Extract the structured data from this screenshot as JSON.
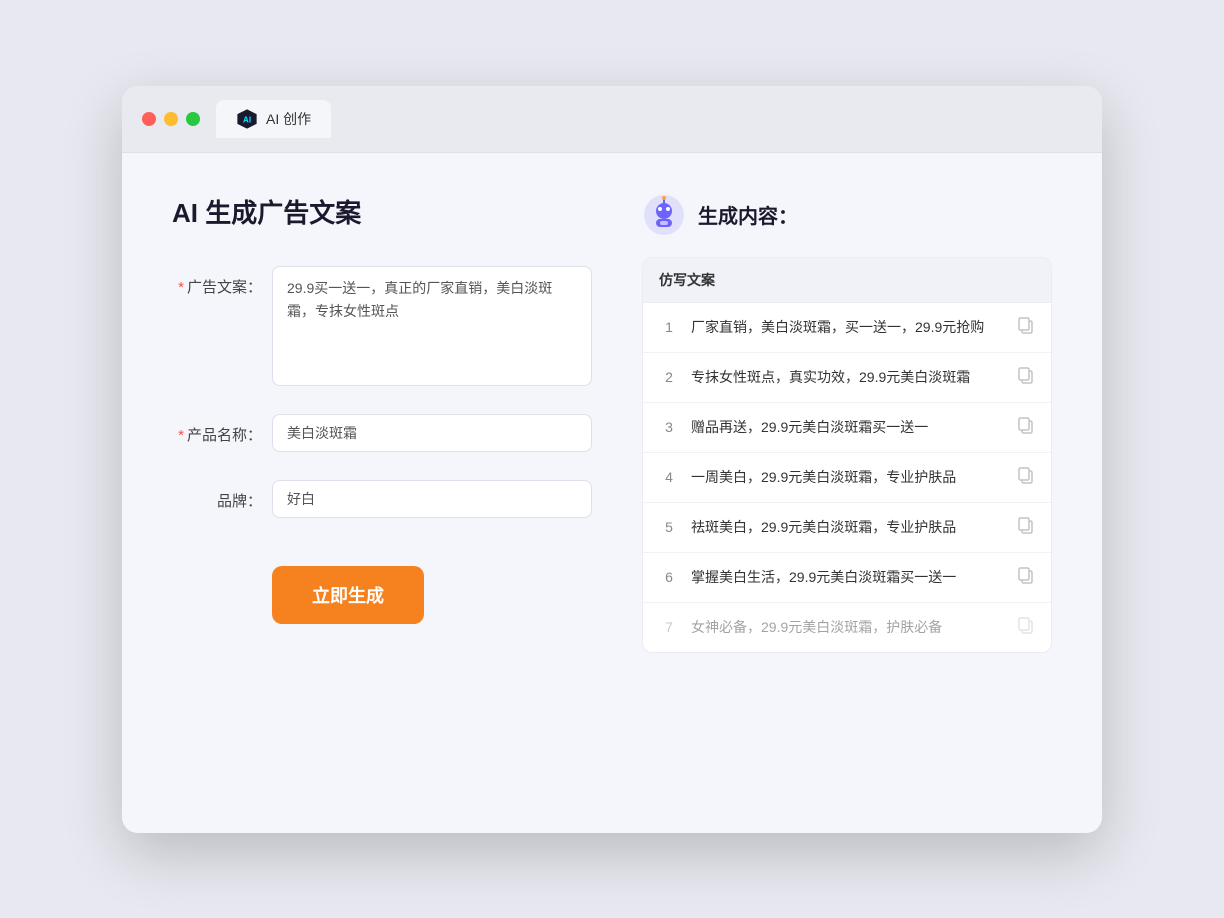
{
  "browser": {
    "tab_label": "AI 创作",
    "traffic_lights": [
      "red",
      "yellow",
      "green"
    ]
  },
  "page": {
    "title": "AI 生成广告文案",
    "form": {
      "ad_copy_label": "广告文案：",
      "ad_copy_required": true,
      "ad_copy_value": "29.9买一送一，真正的厂家直销，美白淡斑霜，专抹女性斑点",
      "product_name_label": "产品名称：",
      "product_name_required": true,
      "product_name_value": "美白淡斑霜",
      "brand_label": "品牌：",
      "brand_required": false,
      "brand_value": "好白",
      "generate_button": "立即生成"
    },
    "result": {
      "header_title": "生成内容：",
      "column_header": "仿写文案",
      "items": [
        {
          "id": 1,
          "text": "厂家直销，美白淡斑霜，买一送一，29.9元抢购",
          "dimmed": false
        },
        {
          "id": 2,
          "text": "专抹女性斑点，真实功效，29.9元美白淡斑霜",
          "dimmed": false
        },
        {
          "id": 3,
          "text": "赠品再送，29.9元美白淡斑霜买一送一",
          "dimmed": false
        },
        {
          "id": 4,
          "text": "一周美白，29.9元美白淡斑霜，专业护肤品",
          "dimmed": false
        },
        {
          "id": 5,
          "text": "祛斑美白，29.9元美白淡斑霜，专业护肤品",
          "dimmed": false
        },
        {
          "id": 6,
          "text": "掌握美白生活，29.9元美白淡斑霜买一送一",
          "dimmed": false
        },
        {
          "id": 7,
          "text": "女神必备，29.9元美白淡斑霜，护肤必备",
          "dimmed": true
        }
      ]
    }
  }
}
